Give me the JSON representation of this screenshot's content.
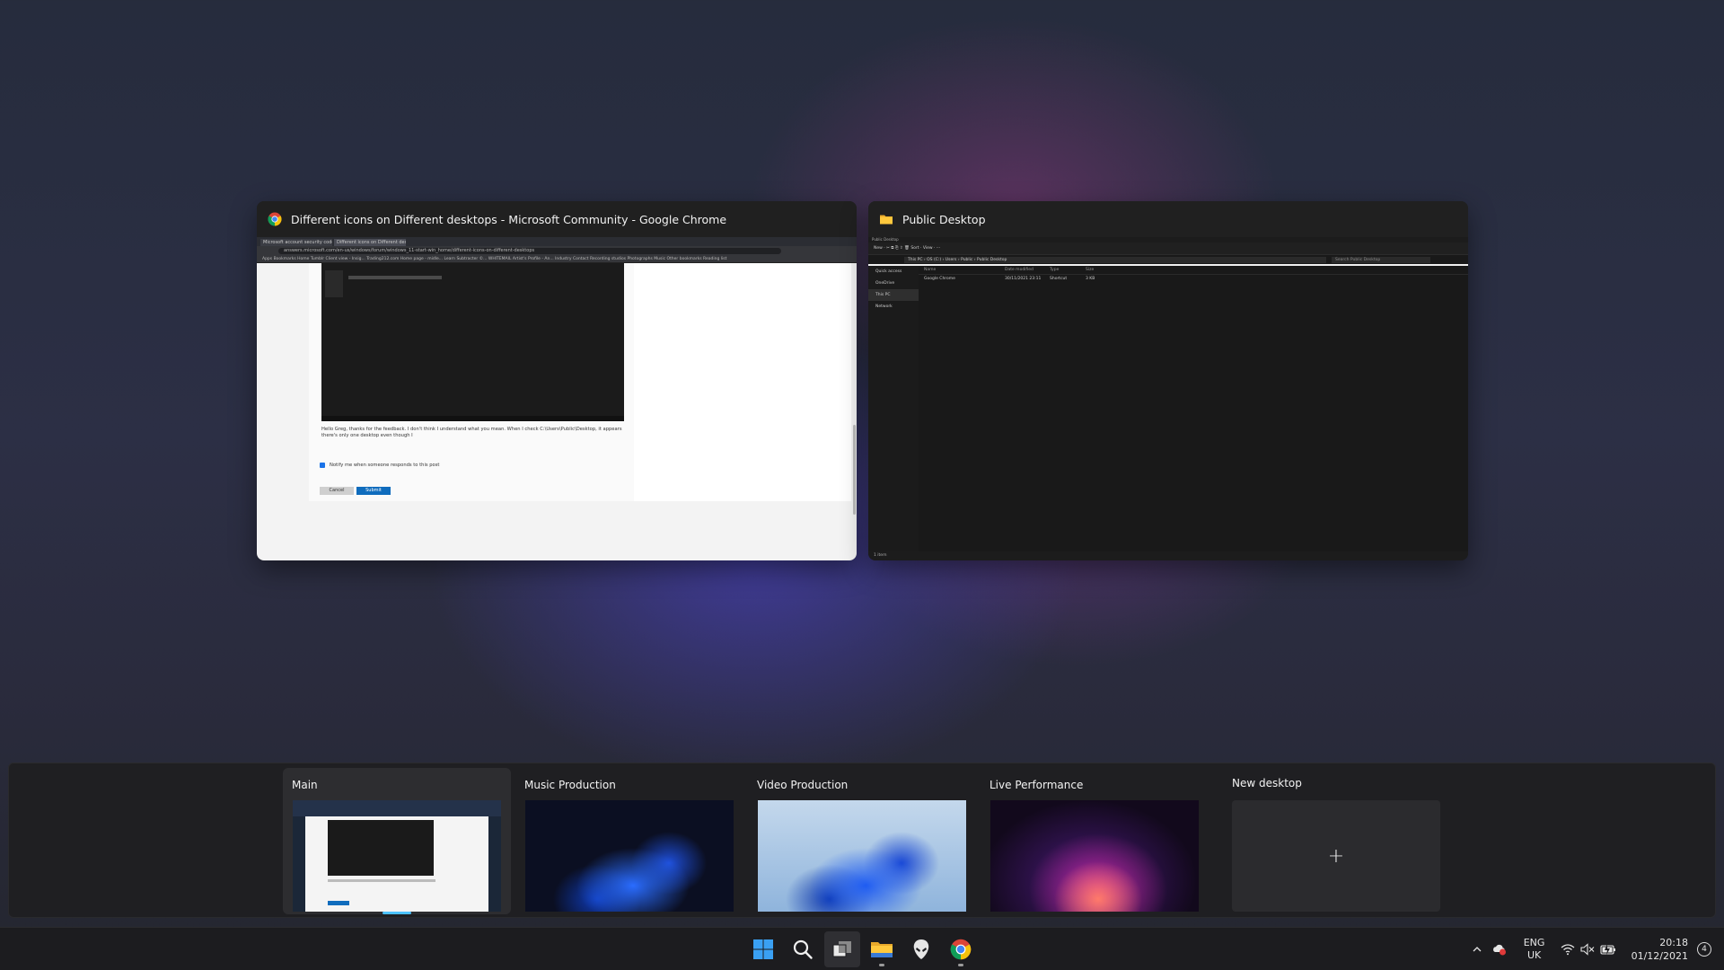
{
  "windows": {
    "chrome": {
      "title": "Different icons on Different desktops - Microsoft Community - Google Chrome",
      "tabs": [
        "Microsoft account security code",
        "Different icons on Different deskt"
      ],
      "url": "answers.microsoft.com/en-us/windows/forum/windows_11-start-win_home/different-icons-on-different-desktops",
      "bookmarks": "Apps   Bookmarks   Home   Tumblr   Client view - Insig...   Trading212.com   Home page - midle...   Learn Subtracter ©...   WHITEMAIL   Artist's Profile - An...   Industry Contact   Recording studios   Photographs   Music   Other bookmarks   Reading list",
      "reply_text": "Hello Greg, thanks for the feedback. I don't think I understand what you mean. When I check C:\\Users\\Public\\Desktop, it appears there's only one desktop even though I",
      "notify_label": "Notify me when someone responds to this post",
      "cancel_label": "Cancel",
      "submit_label": "Submit"
    },
    "explorer": {
      "title": "Public Desktop",
      "top_label": "Public Desktop",
      "command_bar": "New ·   ✂   ⧉   ⎘   ⇪   🗑   Sort ·   View ·   ···",
      "address": "This PC  ›  OS (C:)  ›  Users  ›  Public  ›  Public Desktop",
      "search_placeholder": "Search Public Desktop",
      "nav": [
        "Quick access",
        "OneDrive",
        "This PC",
        "Network"
      ],
      "columns": [
        "Name",
        "Date modified",
        "Type",
        "Size"
      ],
      "rows": [
        [
          "Google Chrome",
          "30/11/2021 23:11",
          "Shortcut",
          "3 KB"
        ]
      ],
      "status": "1 item"
    }
  },
  "desktops": [
    {
      "label": "Main",
      "active": true
    },
    {
      "label": "Music Production",
      "active": false
    },
    {
      "label": "Video Production",
      "active": false
    },
    {
      "label": "Live Performance",
      "active": false
    }
  ],
  "new_desktop": {
    "label": "New desktop",
    "plus": "+"
  },
  "taskbar": {
    "apps": [
      "start-icon",
      "search-icon",
      "task-view-icon",
      "file-explorer-icon",
      "alienware-icon",
      "chrome-icon"
    ],
    "tray": {
      "lang_line1": "ENG",
      "lang_line2": "UK",
      "time": "20:18",
      "date": "01/12/2021",
      "notification_count": "4"
    }
  },
  "colors": {
    "accent": "#4cc2ff",
    "submit_blue": "#0f6cbd",
    "folder_yellow": "#ffc83d"
  }
}
